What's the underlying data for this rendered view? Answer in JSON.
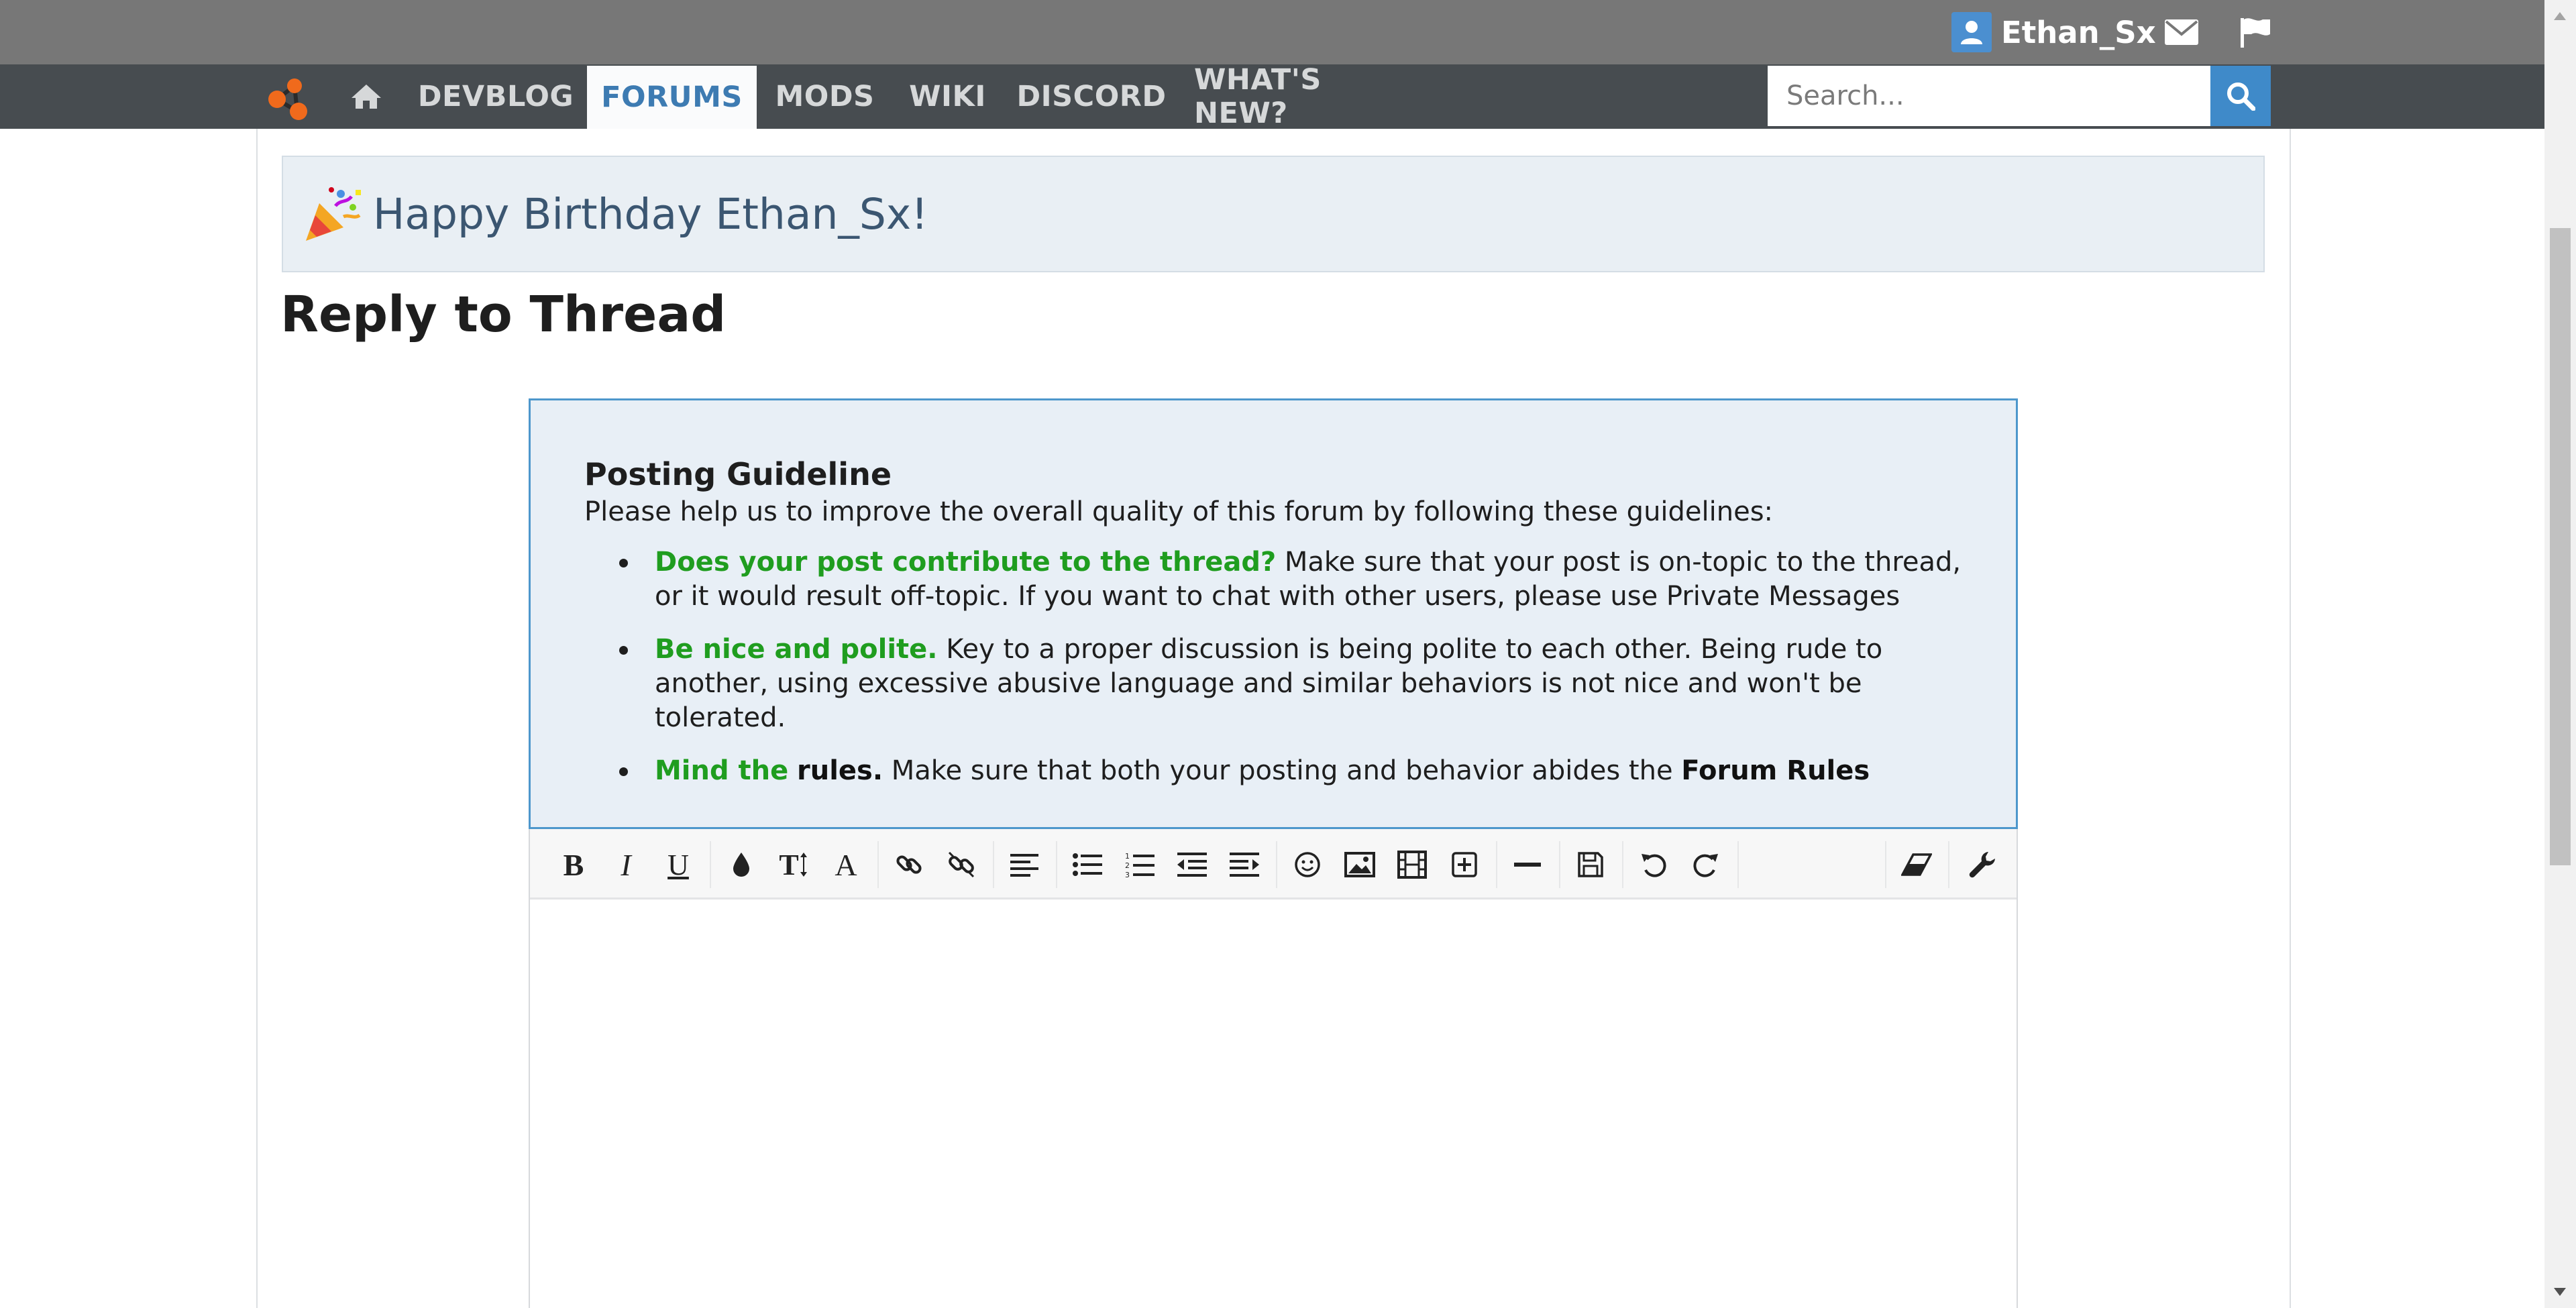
{
  "user": {
    "name": "Ethan_Sx"
  },
  "topbar": {
    "icons": [
      "user-icon",
      "envelope-icon",
      "flag-icon"
    ]
  },
  "nav": {
    "items": [
      {
        "label": "DEVBLOG",
        "active": false
      },
      {
        "label": "FORUMS",
        "active": true
      },
      {
        "label": "MODS",
        "active": false
      },
      {
        "label": "WIKI",
        "active": false
      },
      {
        "label": "DISCORD",
        "active": false
      },
      {
        "label": "WHAT'S NEW?",
        "active": false
      }
    ],
    "icons": [
      "logo-icon",
      "home-icon"
    ]
  },
  "search": {
    "placeholder": "Search...",
    "value": ""
  },
  "notice": {
    "icon": "party-popper-icon",
    "text": "Happy Birthday Ethan_Sx!"
  },
  "page": {
    "title": "Reply to Thread"
  },
  "guidelines": {
    "title": "Posting Guideline",
    "intro": "Please help us to improve the overall quality of this forum by following these guidelines:",
    "items": [
      {
        "highlight": "Does your post contribute to the thread?",
        "text": " Make sure that your post is on-topic to the thread, or it would result off-topic. If you want to chat with other users, please use Private Messages"
      },
      {
        "highlight": "Be nice and polite.",
        "text": " Key to a proper discussion is being polite to each other. Being rude to another, using excessive abusive language and similar behaviors is not nice and won't be tolerated."
      },
      {
        "highlight": "Mind the",
        "strong1": "rules.",
        "text": " Make sure that both your posting and behavior abides the ",
        "strong2": "Forum Rules"
      }
    ]
  },
  "editor": {
    "bold_label": "B",
    "italic_label": "I",
    "underline_label": "U",
    "font_size_label": "T",
    "font_label": "A",
    "tools": [
      "bold",
      "italic",
      "underline",
      "text-color",
      "font-size",
      "font-family",
      "link",
      "unlink",
      "align",
      "bullet-list",
      "numbered-list",
      "outdent",
      "indent",
      "smilies",
      "image",
      "media",
      "insert",
      "horizontal-rule",
      "save-draft",
      "undo",
      "redo",
      "remove-formatting",
      "toggle-bbcode"
    ],
    "content": ""
  },
  "colors": {
    "topbar": "#777777",
    "navbar": "#474c50",
    "accent": "#3f8ac9",
    "guideline_highlight": "#1f9d1f",
    "notice_bg": "#e9eff4"
  }
}
